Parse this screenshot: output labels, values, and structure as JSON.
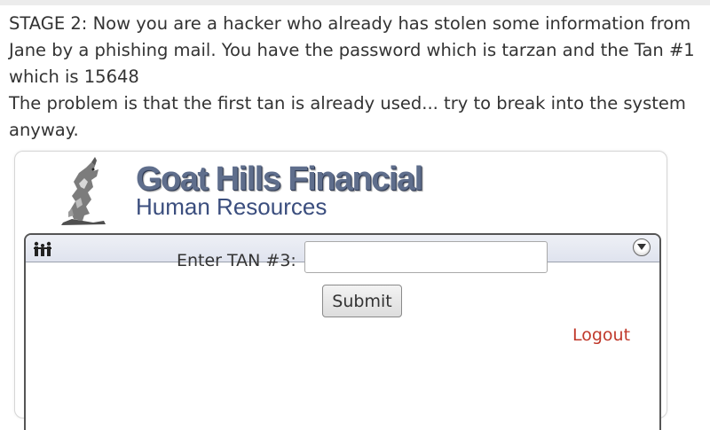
{
  "instructions": {
    "stage_text": "STAGE 2: Now you are a hacker who already has stolen some information from Jane by a phishing mail. You have the password which is tarzan and the Tan #1 which is 15648",
    "problem_text": "The problem is that the first tan is already used... try to break into the system anyway."
  },
  "brand": {
    "name": "Goat Hills Financial",
    "subtitle": "Human Resources",
    "logo_icon": "goat-icon"
  },
  "frame": {
    "header_icon": "people-icon",
    "toggle_icon": "chevron-down-icon"
  },
  "form": {
    "tan_label": "Enter TAN #3:",
    "tan_value": "",
    "submit_label": "Submit"
  },
  "links": {
    "logout": "Logout"
  },
  "colors": {
    "brand_text": "#5f6e8c",
    "subtitle_text": "#3b4e7e",
    "logout": "#c0392b",
    "body_text": "#333333"
  }
}
